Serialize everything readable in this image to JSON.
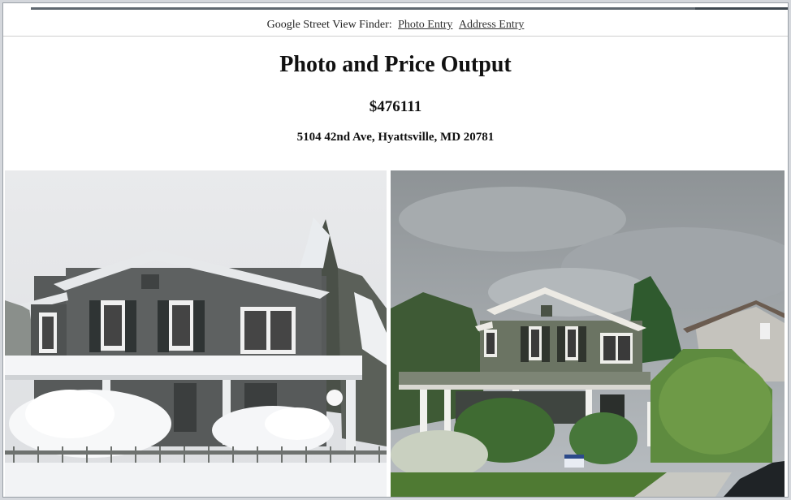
{
  "nav": {
    "prefix": "Google Street View Finder:",
    "links": [
      "Photo Entry",
      "Address Entry"
    ]
  },
  "page": {
    "title": "Photo and Price Output",
    "price": "$476111",
    "address": "5104 42nd Ave, Hyattsville, MD 20781"
  },
  "photos": [
    {
      "name": "uploaded-house-photo",
      "scene": "snowy"
    },
    {
      "name": "street-view-photo",
      "scene": "summer"
    }
  ],
  "colors": {
    "siding": "#5a5d5c",
    "siding_green": "#6b7463",
    "trim": "#f2f2f2",
    "snow": "#f5f6f8",
    "sky_grey": "#9ea3a6",
    "foliage": "#3f6b32"
  }
}
